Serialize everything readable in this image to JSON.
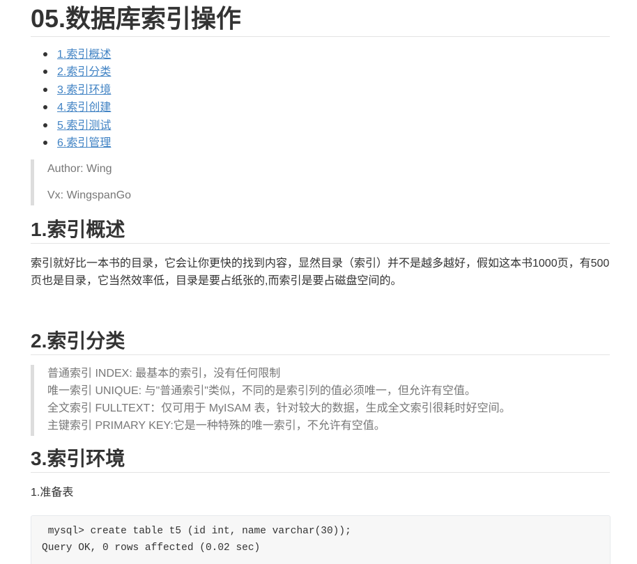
{
  "title": "05.数据库索引操作",
  "toc": [
    {
      "num": "1.",
      "text": "索引概述"
    },
    {
      "num": "2.",
      "text": "索引分类"
    },
    {
      "num": "3.",
      "text": "索引环境"
    },
    {
      "num": "4.",
      "text": "索引创建"
    },
    {
      "num": "5.",
      "text": "索引测试"
    },
    {
      "num": "6.",
      "text": "索引管理"
    }
  ],
  "author_block": {
    "author": "Author: Wing",
    "vx": "Vx: WingspanGo"
  },
  "sections": [
    {
      "heading": "1.索引概述",
      "paragraph": "索引就好比一本书的目录，它会让你更快的找到内容，显然目录（索引）并不是越多越好，假如这本书1000页，有500页也是目录，它当然效率低，目录是要占纸张的,而索引是要占磁盘空间的。"
    },
    {
      "heading": "2.索引分类",
      "quote_lines": [
        "普通索引 INDEX: 最基本的索引，没有任何限制",
        "唯一索引 UNIQUE: 与\"普通索引\"类似，不同的是索引列的值必须唯一，但允许有空值。",
        "全文索引 FULLTEXT：仅可用于 MyISAM 表，针对较大的数据，生成全文索引很耗时好空间。",
        "主键索引 PRIMARY KEY:它是一种特殊的唯一索引，不允许有空值。"
      ]
    },
    {
      "heading": "3.索引环境",
      "paragraph": "1.准备表",
      "code_lines": [
        " mysql> create table t5 (id int, name varchar(30));",
        "Query OK, 0 rows affected (0.02 sec)"
      ]
    }
  ]
}
